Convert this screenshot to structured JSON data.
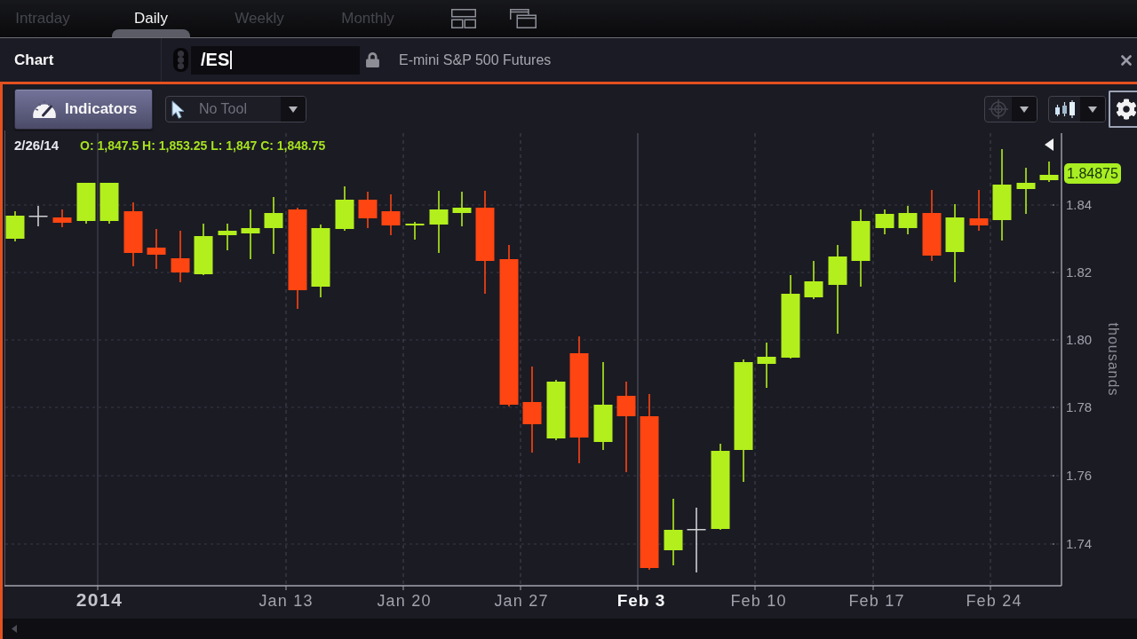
{
  "view_tabs": [
    {
      "label": "Intraday",
      "selected": false
    },
    {
      "label": "Daily",
      "selected": true
    },
    {
      "label": "Weekly",
      "selected": false
    },
    {
      "label": "Monthly",
      "selected": false
    }
  ],
  "header": {
    "title": "Chart",
    "symbol": {
      "value": "/ES"
    },
    "description": "E-mini S&P 500 Futures"
  },
  "toolbar": {
    "indicators_button": "Indicators",
    "drawing_tool": {
      "label": "No Tool"
    }
  },
  "legend": {
    "date": "2/26/14",
    "ohlc": "O: 1,847.5 H: 1,853.25 L: 1,847 C: 1,848.75"
  },
  "price_axis": {
    "labels": [
      "1.84",
      "1.82",
      "1.80",
      "1.78",
      "1.76",
      "1.74"
    ],
    "unit": "thousands",
    "last_price": "1.84875"
  },
  "time_axis": {
    "labels": [
      {
        "text": "2014",
        "kind": "year"
      },
      {
        "text": "Jan 13",
        "kind": "week"
      },
      {
        "text": "Jan 20",
        "kind": "week"
      },
      {
        "text": "Jan 27",
        "kind": "week"
      },
      {
        "text": "Feb 3",
        "kind": "month"
      },
      {
        "text": "Feb 10",
        "kind": "week"
      },
      {
        "text": "Feb 17",
        "kind": "week"
      },
      {
        "text": "Feb 24",
        "kind": "week"
      }
    ]
  }
}
